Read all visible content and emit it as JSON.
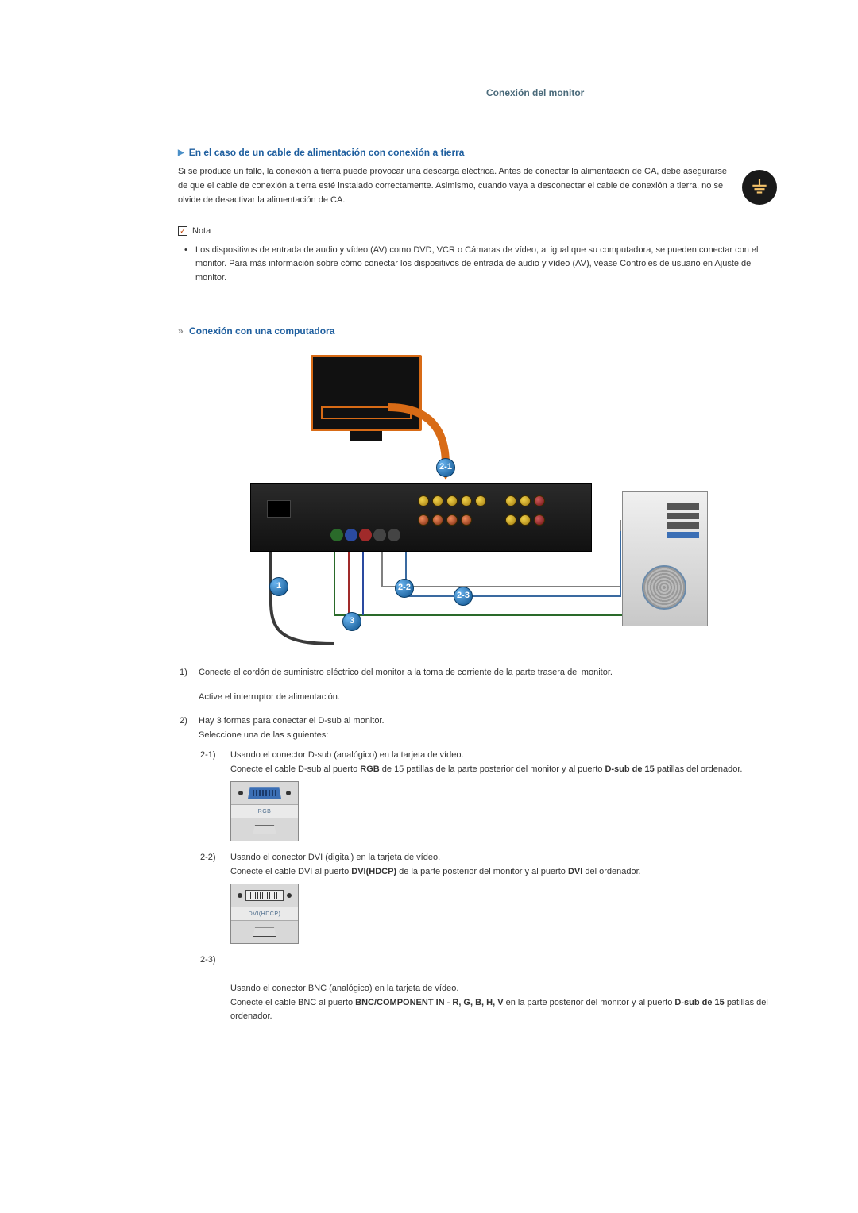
{
  "header_link": "Conexión del monitor",
  "section_ground": {
    "title": "En el caso de un cable de alimentación con conexión a tierra",
    "body": "Si se produce un fallo, la conexión a tierra puede provocar una descarga eléctrica. Antes de conectar la alimentación de CA, debe asegurarse de que el cable de conexión a tierra esté instalado correctamente. Asimismo, cuando vaya a desconectar el cable de conexión a tierra, no se olvide de desactivar la alimentación de CA."
  },
  "note": {
    "label": "Nota",
    "bullet": "Los dispositivos de entrada de audio y vídeo (AV) como DVD, VCR o Cámaras de vídeo, al igual que su computadora, se pueden conectar con el monitor. Para más información sobre cómo conectar los dispositivos de entrada de audio y vídeo (AV), véase Controles de usuario en Ajuste del monitor."
  },
  "section_pc": {
    "title": "Conexión con una computadora",
    "diagram_labels": {
      "l1": "1",
      "l21": "2-1",
      "l22": "2-2",
      "l23": "2-3",
      "l3": "3"
    }
  },
  "steps": {
    "s1_num": "1)",
    "s1_a": "Conecte el cordón de suministro eléctrico del monitor a la toma de corriente de la parte trasera del monitor.",
    "s1_b": "Active el interruptor de alimentación.",
    "s2_num": "2)",
    "s2_a": "Hay 3 formas para conectar el D-sub al monitor.",
    "s2_b": "Seleccione una de las siguientes:",
    "s21_num": "2-1)",
    "s21_a": "Usando el conector D-sub (analógico) en la tarjeta de vídeo.",
    "s21_b_pre": "Conecte el cable D-sub al puerto ",
    "s21_b_bold1": "RGB",
    "s21_b_mid": " de 15 patillas de la parte posterior del monitor y al puerto ",
    "s21_b_bold2": "D-sub de 15",
    "s21_b_post": " patillas del ordenador.",
    "s21_port_label": "RGB",
    "s22_num": "2-2)",
    "s22_a": "Usando el conector DVI (digital) en la tarjeta de vídeo.",
    "s22_b_pre": "Conecte el cable DVI al puerto ",
    "s22_b_bold1": "DVI(HDCP)",
    "s22_b_mid": " de la parte posterior del monitor y al puerto ",
    "s22_b_bold2": "DVI",
    "s22_b_post": " del ordenador.",
    "s22_port_label": "DVI(HDCP)",
    "s23_num": "2-3)",
    "s23_a": "Usando el conector BNC (analógico) en la tarjeta de vídeo.",
    "s23_b_pre": "Conecte el cable BNC al puerto ",
    "s23_b_bold1": "BNC/COMPONENT IN - R, G, B, H, V",
    "s23_b_mid": " en la parte posterior del monitor y al puerto ",
    "s23_b_bold2": "D-sub de 15",
    "s23_b_post": " patillas del ordenador."
  }
}
